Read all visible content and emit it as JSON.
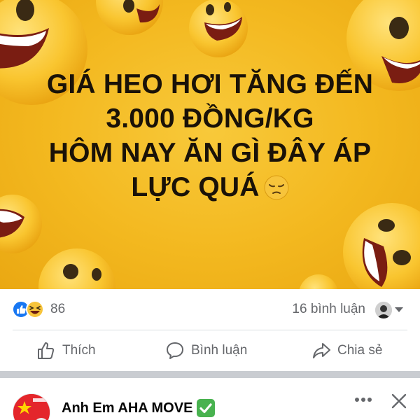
{
  "post": {
    "headline_lines": [
      "GIÁ HEO HƠI TĂNG ĐẾN",
      "3.000 ĐỒNG/KG",
      "HÔM NAY ĂN GÌ ĐÂY ÁP",
      "LỰC QUÁ"
    ],
    "headline_emoji": "pensive-face-icon",
    "background_color": "#f3b81f"
  },
  "reactions": {
    "count": "86",
    "types": [
      "like",
      "haha"
    ],
    "comments": "16 bình luận"
  },
  "actions": {
    "like": "Thích",
    "comment": "Bình luận",
    "share": "Chia sẻ"
  },
  "next_post": {
    "page_name": "Anh Em AHA MOVE",
    "badge_icon": "check-mark-icon",
    "badge_color": "#48b24f"
  },
  "colors": {
    "like_blue": "#1877f2",
    "haha_yellow": "#f7c43b",
    "secondary_text": "#65676b",
    "separator": "#c9ccd1"
  }
}
